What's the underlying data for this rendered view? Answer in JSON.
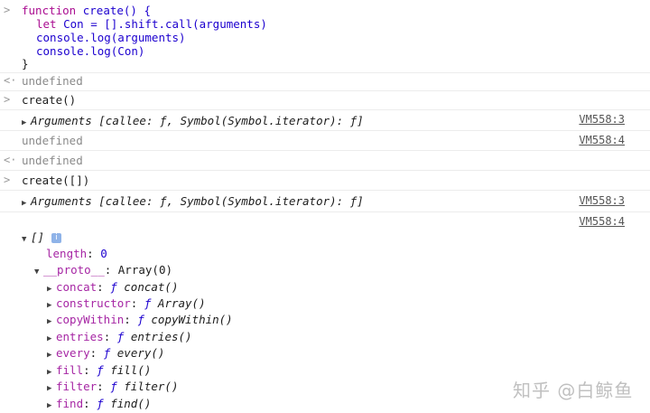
{
  "code_block": {
    "l1_kw": "function",
    "l1_rest": "create() {",
    "l2_kw": "let",
    "l2_rest": "Con = [].shift.call(arguments)",
    "l3": "console.log(arguments)",
    "l4": "console.log(Con)",
    "l5": "}"
  },
  "results": {
    "undefined_text": "undefined",
    "cmd1": "create()",
    "cmd2": "create([])",
    "arguments_label": "Arguments",
    "arguments_detail": "[callee: ƒ, Symbol(Symbol.iterator): ƒ]",
    "src_vm3": "VM558:3",
    "src_vm4": "VM558:4"
  },
  "array_tree": {
    "root_label": "[]",
    "info_icon": "i",
    "length_key": "length",
    "length_sep": ": ",
    "length_val": "0",
    "proto_key": "__proto__",
    "proto_val": ": Array(0)",
    "methods": [
      {
        "key": "concat",
        "sig": "concat()"
      },
      {
        "key": "constructor",
        "sig": "Array()"
      },
      {
        "key": "copyWithin",
        "sig": "copyWithin()"
      },
      {
        "key": "entries",
        "sig": "entries()"
      },
      {
        "key": "every",
        "sig": "every()"
      },
      {
        "key": "fill",
        "sig": "fill()"
      },
      {
        "key": "filter",
        "sig": "filter()"
      },
      {
        "key": "find",
        "sig": "find()"
      }
    ]
  },
  "glyphs": {
    "prompt_in": ">",
    "prompt_out": "<·",
    "tri_right": "▶",
    "tri_down": "▼",
    "f_glyph": "ƒ"
  },
  "watermark": "知乎 @白鲸鱼"
}
